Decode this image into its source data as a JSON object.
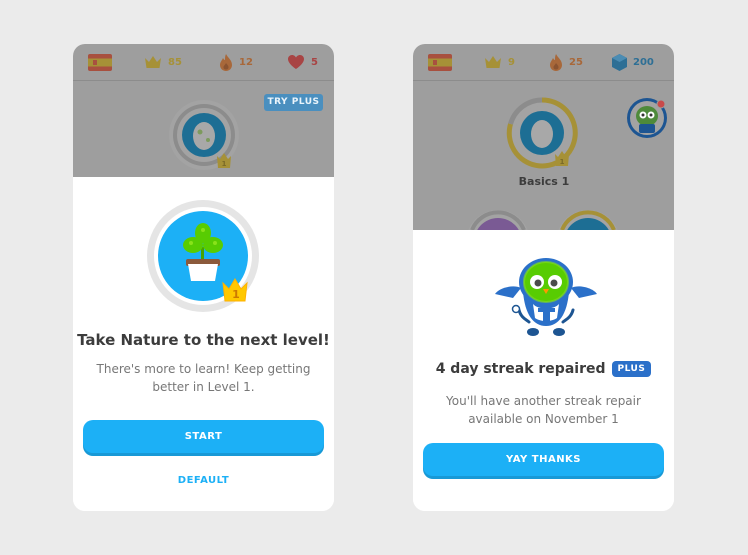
{
  "left": {
    "stats": {
      "flag_icon": "spain-flag-icon",
      "crowns": "85",
      "streak": "12",
      "hearts": "5"
    },
    "try_plus": "TRY PLUS",
    "skill_icon": "plant-icon",
    "crown_level": "1",
    "title": "Take Nature to the next level!",
    "body": "There's more to learn! Keep getting better in Level 1.",
    "start_button": "START",
    "default_link": "DEFAULT"
  },
  "right": {
    "stats": {
      "flag_icon": "spain-flag-icon",
      "crowns": "9",
      "streak": "25",
      "gems": "200"
    },
    "skill_label": "Basics 1",
    "skill_crown_level": "1",
    "title": "4 day streak repaired",
    "plus_badge": "PLUS",
    "body": "You'll have another streak repair available on November 1",
    "yay_button": "YAY THANKS"
  },
  "colors": {
    "blue": "#1cb0f6",
    "gold": "#ffc800",
    "orange": "#ff9600",
    "red": "#ff4b4b",
    "green": "#58cc02",
    "navy": "#2b70c9"
  }
}
